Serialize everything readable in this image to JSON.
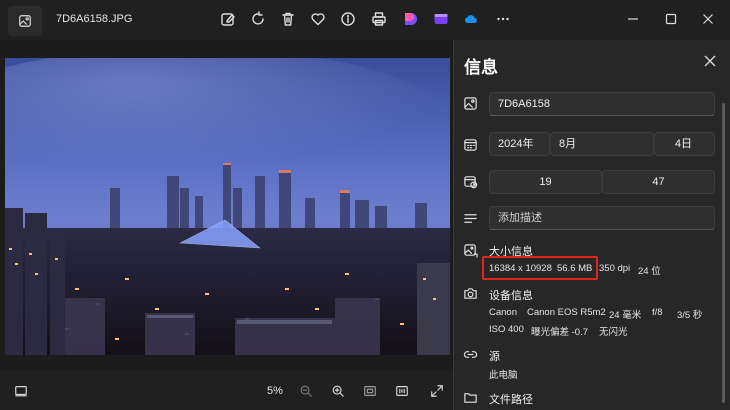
{
  "title_bar": {
    "file_name": "7D6A6158.JPG"
  },
  "toolbar": {
    "icons": [
      "edit-image-icon",
      "rotate-icon",
      "delete-icon",
      "favorite-icon",
      "info-icon",
      "print-icon",
      "designer-app-icon",
      "clipchamp-app-icon",
      "onedrive-icon",
      "more-icon"
    ]
  },
  "viewer": {
    "zoom_level": "5%"
  },
  "info_panel": {
    "title": "信息",
    "name": "7D6A6158",
    "date": {
      "year": "2024年",
      "month": "8月",
      "day": "4日"
    },
    "time": {
      "hour": "19",
      "minute": "47"
    },
    "description_placeholder": "添加描述",
    "size_section": {
      "label": "大小信息",
      "dimensions": "16384 x 10928",
      "file_size": "56.6 MB",
      "dpi": "350 dpi",
      "bit_depth": "24 位"
    },
    "device_section": {
      "label": "设备信息",
      "make": "Canon",
      "model": "Canon EOS R5m2",
      "focal_length": "24 毫米",
      "aperture": "f/8",
      "exposure_time": "3/5 秒",
      "iso": "ISO 400",
      "exposure_bias": "曝光偏差 -0.7",
      "flash": "无闪光"
    },
    "source_section": {
      "label": "源",
      "value": "此电脑"
    },
    "path_section": {
      "label": "文件路径"
    }
  },
  "colors": {
    "highlight": "#e0241b",
    "panel_bg": "#272727",
    "titlebar_bg": "#202020"
  }
}
